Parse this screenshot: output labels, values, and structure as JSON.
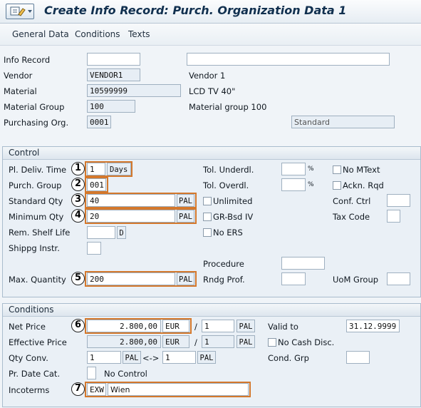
{
  "window": {
    "title": "Create Info Record: Purch. Organization Data 1"
  },
  "menu": [
    "General Data",
    "Conditions",
    "Texts"
  ],
  "header": {
    "info_record_label": "Info Record",
    "vendor_label": "Vendor",
    "vendor_value": "VENDOR1",
    "vendor_desc": "Vendor 1",
    "material_label": "Material",
    "material_value": "10599999",
    "material_desc": "LCD TV 40\"",
    "matgroup_label": "Material Group",
    "matgroup_value": "100",
    "matgroup_desc": "Material group 100",
    "porg_label": "Purchasing Org.",
    "porg_value": "0001",
    "porg_type": "Standard"
  },
  "control": {
    "title": "Control",
    "pl_deliv_label": "Pl. Deliv. Time",
    "pl_deliv_value": "1",
    "pl_deliv_unit": "Days",
    "purch_group_label": "Purch. Group",
    "purch_group_value": "001",
    "std_qty_label": "Standard Qty",
    "std_qty_value": "40",
    "std_qty_unit": "PAL",
    "min_qty_label": "Minimum Qty",
    "min_qty_value": "20",
    "min_qty_unit": "PAL",
    "shelf_life_label": "Rem. Shelf Life",
    "shelf_life_unit": "D",
    "shipping_label": "Shippg Instr.",
    "max_qty_label": "Max. Quantity",
    "max_qty_value": "200",
    "max_qty_unit": "PAL",
    "tol_under_label": "Tol. Underdl.",
    "tol_over_label": "Tol. Overdl.",
    "pct": "%",
    "unlimited_label": "Unlimited",
    "grbsd_label": "GR-Bsd IV",
    "noers_label": "No ERS",
    "procedure_label": "Procedure",
    "rndg_label": "Rndg Prof.",
    "nomtext_label": "No MText",
    "acknrqd_label": "Ackn. Rqd",
    "confctrl_label": "Conf. Ctrl",
    "taxcode_label": "Tax Code",
    "uomgroup_label": "UoM Group"
  },
  "conditions": {
    "title": "Conditions",
    "net_price_label": "Net Price",
    "net_price_value": "2.800,00",
    "net_price_curr": "EUR",
    "net_per": "1",
    "net_unit": "PAL",
    "eff_price_label": "Effective Price",
    "eff_price_value": "2.800,00",
    "eff_price_curr": "EUR",
    "eff_per": "1",
    "eff_unit": "PAL",
    "qty_conv_label": "Qty Conv.",
    "qty_conv_left": "1",
    "qty_conv_left_unit": "PAL",
    "qty_conv_arrow": "<->",
    "qty_conv_right": "1",
    "qty_conv_right_unit": "PAL",
    "pr_date_label": "Pr. Date Cat.",
    "pr_date_text": "No Control",
    "incoterms_label": "Incoterms",
    "incoterms_code": "EXW",
    "incoterms_place": "Wien",
    "valid_to_label": "Valid to",
    "valid_to_value": "31.12.9999",
    "no_cash_label": "No Cash Disc.",
    "cond_grp_label": "Cond. Grp",
    "slash": "/"
  },
  "badges": [
    "1",
    "2",
    "3",
    "4",
    "5",
    "6",
    "7"
  ],
  "colors": {
    "highlight": "#d4782c",
    "title": "#11304f"
  }
}
